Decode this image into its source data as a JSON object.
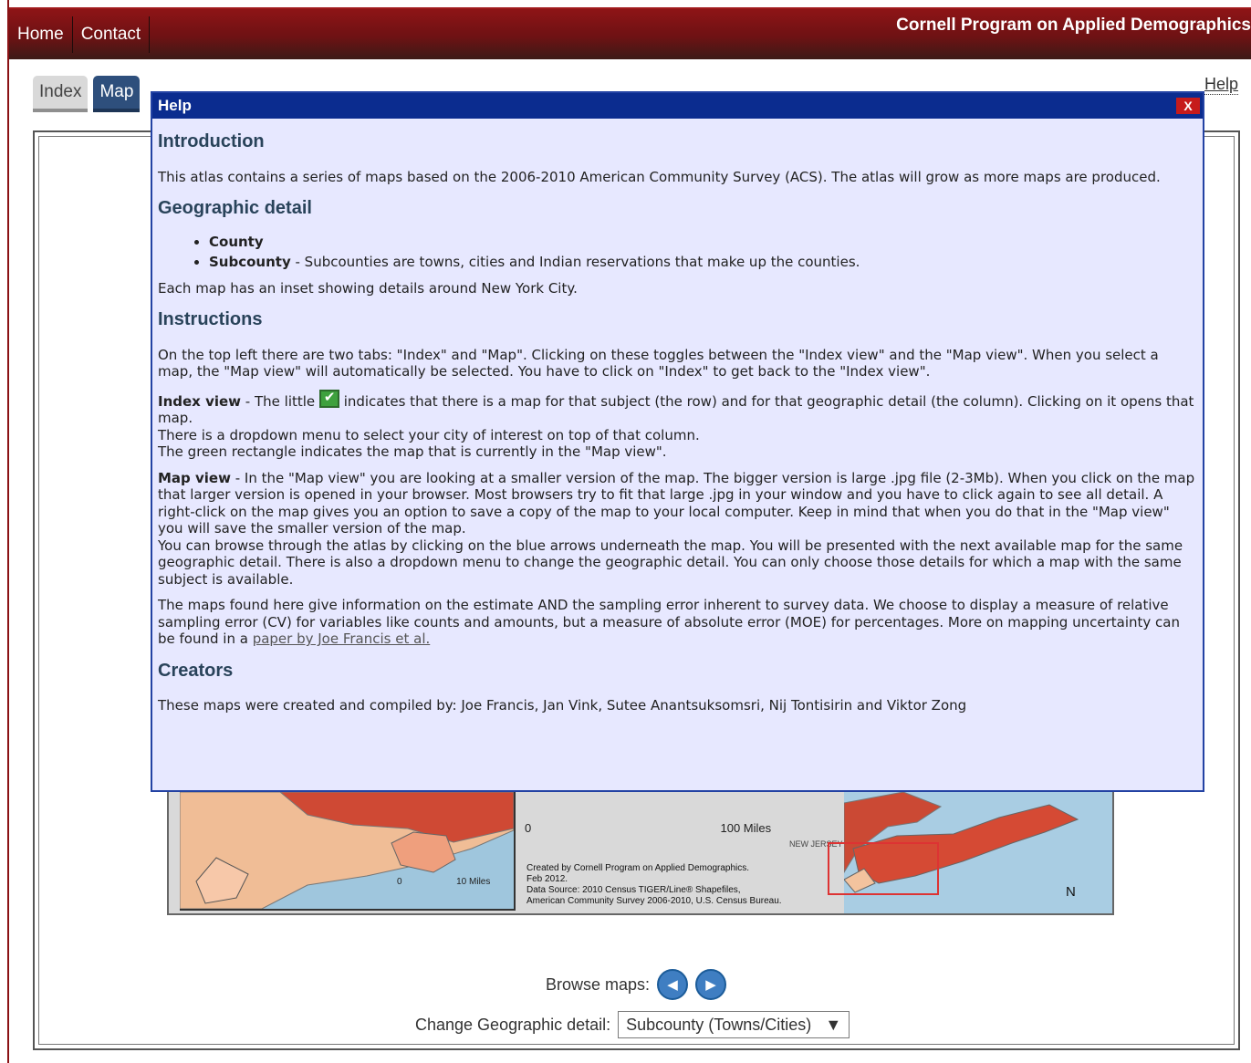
{
  "topnav": {
    "home": "Home",
    "contact": "Contact",
    "brand": "Cornell Program on Applied Demographics"
  },
  "tabs": {
    "index": "Index",
    "map": "Map",
    "help": "Help"
  },
  "map": {
    "scale_main_0": "0",
    "scale_main_100": "100 Miles",
    "scale_inset_0": "0",
    "scale_inset_10": "10 Miles",
    "state_label": "NEW JERSEY",
    "credits": [
      "Created by Cornell Program on Applied Demographics.",
      "Feb 2012.",
      "Data Source: 2010 Census TIGER/Line® Shapefiles,",
      "American Community Survey 2006-2010, U.S. Census Bureau."
    ],
    "north": "N"
  },
  "controls": {
    "browse_label": "Browse maps:",
    "change_label": "Change Geographic detail:",
    "selected_detail": "Subcounty (Towns/Cities)"
  },
  "help_dialog": {
    "title": "Help",
    "close": "X",
    "intro_heading": "Introduction",
    "intro_text": "This atlas contains a series of maps based on the 2006-2010 American Community Survey (ACS). The atlas will grow as more maps are produced.",
    "geo_heading": "Geographic detail",
    "geo_county": "County",
    "geo_subcounty": "Subcounty",
    "geo_subcounty_text": " - Subcounties are towns, cities and Indian reservations that make up the counties.",
    "geo_inset": "Each map has an inset showing details around New York City.",
    "instructions_heading": "Instructions",
    "instructions_text": "On the top left there are two tabs: \"Index\" and \"Map\". Clicking on these toggles between the \"Index view\" and the \"Map view\". When you select a map, the \"Map view\" will automatically be selected. You have to click on \"Index\" to get back to the \"Index view\".",
    "index_view_label": "Index view",
    "index_view_before": " - The little ",
    "index_view_after": " indicates that there is a map for that subject (the row) and for that geographic detail (the column). Clicking on it opens that map.",
    "index_view_line2": "There is a dropdown menu to select your city of interest on top of that column.",
    "index_view_line3": "The green rectangle indicates the map that is currently in the \"Map view\".",
    "map_view_label": "Map view",
    "map_view_text": " - In the \"Map view\" you are looking at a smaller version of the map. The bigger version is large .jpg file (2-3Mb). When you click on the map that larger version is opened in your browser. Most browsers try to fit that large .jpg in your window and you have to click again to see all detail. A right-click on the map gives you an option to save a copy of the map to your local computer. Keep in mind that when you do that in the \"Map view\" you will save the smaller version of the map.",
    "map_view_line2": "You can browse through the atlas by clicking on the blue arrows underneath the map. You will be presented with the next available map for the same geographic detail. There is also a dropdown menu to change the geographic detail. You can only choose those details for which a map with the same subject is available.",
    "uncertainty_text": "The maps found here give information on the estimate AND the sampling error inherent to survey data. We choose to display a measure of relative sampling error (CV) for variables like counts and amounts, but a measure of absolute error (MOE) for percentages. More on mapping uncertainty can be found in a ",
    "paper_link": "paper by Joe Francis et al.",
    "creators_heading": "Creators",
    "creators_text": "These maps were created and compiled by: Joe Francis, Jan Vink, Sutee Anantsuksomsri, Nij Tontisirin and Viktor Zong"
  }
}
